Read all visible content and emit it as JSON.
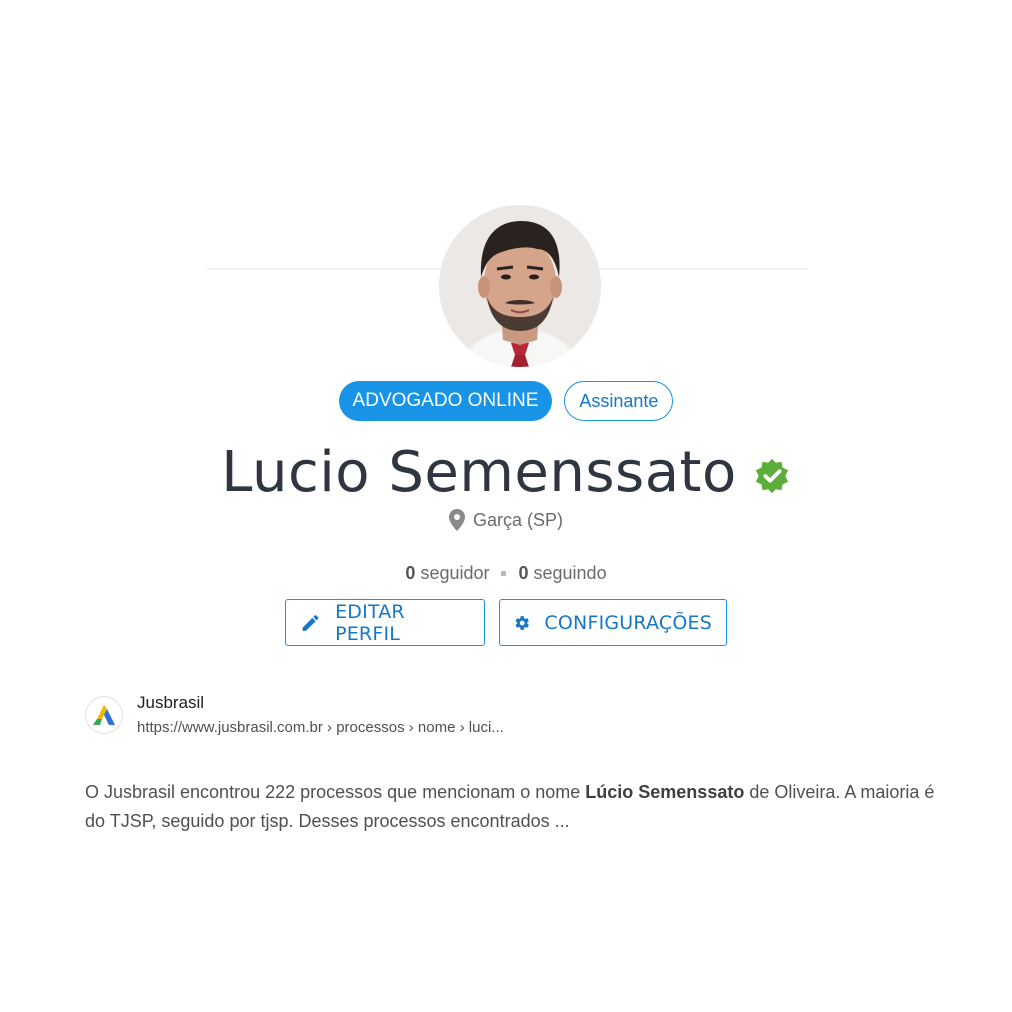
{
  "profile": {
    "badge_primary": "ADVOGADO ONLINE",
    "badge_secondary": "Assinante",
    "name": "Lucio Semenssato",
    "verified_icon": "verified-check-icon",
    "location": "Garça (SP)",
    "followers_count": "0",
    "followers_label": "seguidor",
    "following_count": "0",
    "following_label": "seguindo",
    "edit_button": "EDITAR PERFIL",
    "settings_button": "CONFIGURAÇÕES",
    "accent_color": "#1893e6",
    "verified_color": "#5cae3a"
  },
  "search_result": {
    "site_name": "Jusbrasil",
    "url": "https://www.jusbrasil.com.br › processos › nome › luci...",
    "snippet_before": "O Jusbrasil encontrou 222 processos que mencionam o nome ",
    "snippet_bold": "Lúcio Semenssato",
    "snippet_after": " de Oliveira. A maioria é do TJSP, seguido por tjsp. Desses processos encontrados ..."
  }
}
